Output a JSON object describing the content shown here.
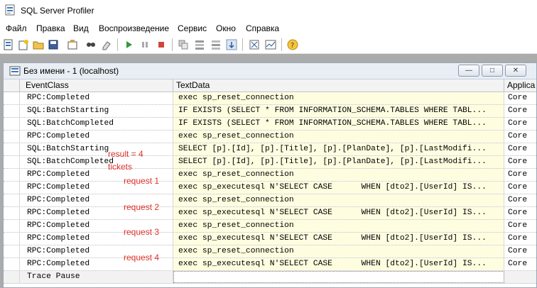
{
  "window": {
    "title": "SQL Server Profiler",
    "icon": "profiler-app-icon"
  },
  "menu": [
    "Файл",
    "Правка",
    "Вид",
    "Воспроизведение",
    "Сервис",
    "Окно",
    "Справка"
  ],
  "toolbar_icons": [
    "new-trace-icon",
    "properties-icon",
    "open-icon",
    "save-icon",
    "template-icon",
    "find-icon",
    "clear-icon",
    "run-icon",
    "pause-icon",
    "stop-icon",
    "auto-scroll-icon",
    "group-icon",
    "ungroup-icon",
    "scroll-icon",
    "tuning-advisor-icon",
    "perfmon-icon",
    "help-icon"
  ],
  "child_window": {
    "title": "Без имени - 1 (localhost)",
    "buttons": [
      "—",
      "□",
      "✕"
    ]
  },
  "columns": [
    "EventClass",
    "TextData",
    "Applica"
  ],
  "rows": [
    {
      "event": "RPC:Completed",
      "text": "exec sp_reset_connection",
      "app": "Core"
    },
    {
      "event": "SQL:BatchStarting",
      "text": "IF EXISTS (SELECT * FROM INFORMATION_SCHEMA.TABLES WHERE TABL...",
      "app": "Core"
    },
    {
      "event": "SQL:BatchCompleted",
      "text": "IF EXISTS (SELECT * FROM INFORMATION_SCHEMA.TABLES WHERE TABL...",
      "app": "Core"
    },
    {
      "event": "RPC:Completed",
      "text": "exec sp_reset_connection",
      "app": "Core"
    },
    {
      "event": "SQL:BatchStarting",
      "text": "SELECT [p].[Id], [p].[Title], [p].[PlanDate], [p].[LastModifi...",
      "app": "Core"
    },
    {
      "event": "SQL:BatchCompleted",
      "text": "SELECT [p].[Id], [p].[Title], [p].[PlanDate], [p].[LastModifi...",
      "app": "Core"
    },
    {
      "event": "RPC:Completed",
      "text": "exec sp_reset_connection",
      "app": "Core"
    },
    {
      "event": "RPC:Completed",
      "text": "exec sp_executesql N'SELECT CASE      WHEN [dto2].[UserId] IS...",
      "app": "Core"
    },
    {
      "event": "RPC:Completed",
      "text": "exec sp_reset_connection",
      "app": "Core"
    },
    {
      "event": "RPC:Completed",
      "text": "exec sp_executesql N'SELECT CASE      WHEN [dto2].[UserId] IS...",
      "app": "Core"
    },
    {
      "event": "RPC:Completed",
      "text": "exec sp_reset_connection",
      "app": "Core"
    },
    {
      "event": "RPC:Completed",
      "text": "exec sp_executesql N'SELECT CASE      WHEN [dto2].[UserId] IS...",
      "app": "Core"
    },
    {
      "event": "RPC:Completed",
      "text": "exec sp_reset_connection",
      "app": "Core"
    },
    {
      "event": "RPC:Completed",
      "text": "exec sp_executesql N'SELECT CASE      WHEN [dto2].[UserId] IS...",
      "app": "Core"
    },
    {
      "event": "Trace Pause",
      "text": "",
      "app": ""
    }
  ],
  "annotations": {
    "result": "result = 4",
    "tickets": "tickets",
    "r1": "request 1",
    "r2": "request 2",
    "r3": "request 3",
    "r4": "request 4"
  },
  "colors": {
    "annotation": "#e0322b",
    "textdata_bg": "#fffde0"
  }
}
